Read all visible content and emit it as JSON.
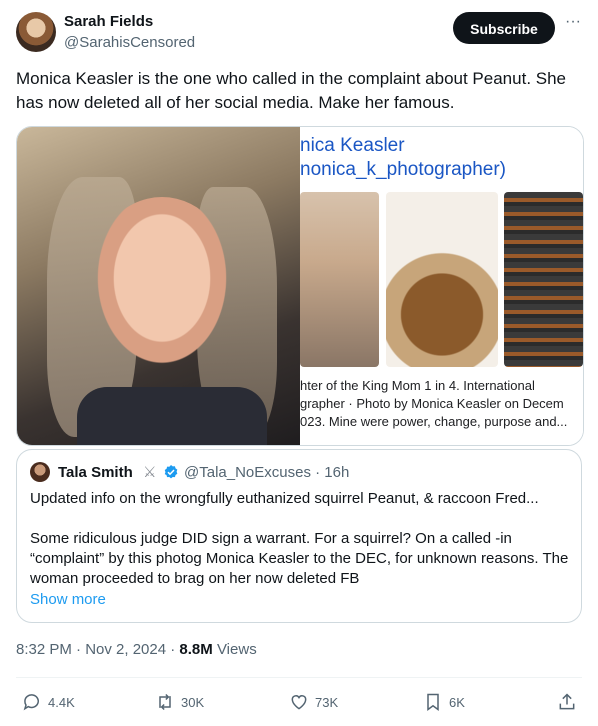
{
  "author": {
    "name": "Sarah Fields",
    "handle": "@SarahisCensored"
  },
  "subscribe_label": "Subscribe",
  "more_label": "···",
  "tweet_text": "Monica Keasler is the one who called in the complaint about Peanut. She has now deleted all of her social media. Make her famous.",
  "media": {
    "profile_name": "nica Keasler",
    "profile_handle": "nonica_k_photographer)",
    "description_lines": [
      "hter of the King Mom 1 in 4. International",
      "grapher · Photo by Monica Keasler on Decem",
      "023. Mine were power, change, purpose and..."
    ]
  },
  "quote": {
    "name": "Tala Smith",
    "emoji": "⚔",
    "handle_time": "@Tala_NoExcuses · 16h",
    "paragraphs": [
      "Updated info on the wrongfully euthanized squirrel Peanut, & raccoon Fred...",
      "Some ridiculous judge DID sign a warrant. For a squirrel? On a called -in “complaint” by this photog Monica Keasler to the DEC, for unknown reasons. The woman proceeded to brag on her now deleted FB"
    ],
    "show_more": "Show more"
  },
  "meta": {
    "time": "8:32 PM · Nov 2, 2024 · ",
    "views_count": "8.8M",
    "views_label": " Views"
  },
  "actions": {
    "replies": "4.4K",
    "reposts": "30K",
    "likes": "73K",
    "bookmarks": "6K"
  },
  "icons": {
    "reply": "reply-icon",
    "repost": "repost-icon",
    "like": "heart-icon",
    "bookmark": "bookmark-icon",
    "share": "share-icon",
    "verified": "verified-badge-icon"
  },
  "colors": {
    "accent": "#1d9bf0",
    "subscribe_bg": "#0f1419",
    "muted_text": "#536471",
    "link_preview": "#1a56c4"
  }
}
